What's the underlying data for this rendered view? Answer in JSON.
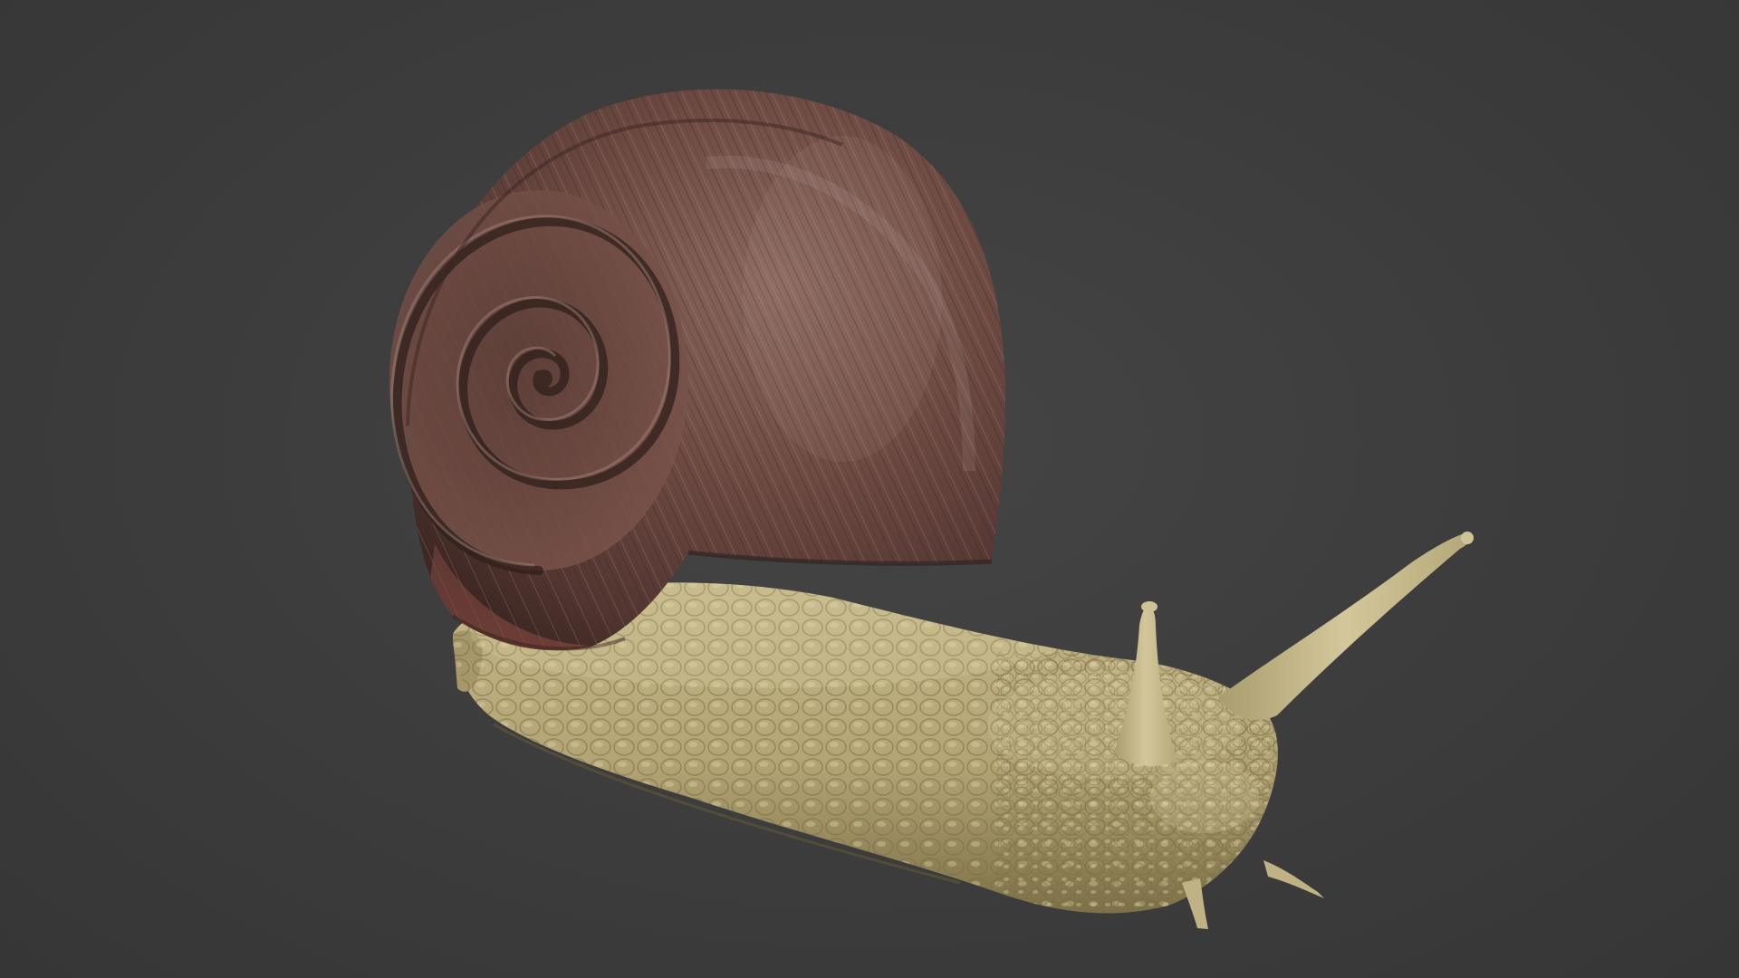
{
  "scene": {
    "subject": "snail-render",
    "colors": {
      "background": "#3d3d3d",
      "shell_base": "#6e4a42",
      "shell_dark": "#3e2a26",
      "shell_highlight": "#9a7870",
      "shell_lip": "#8a4a44",
      "body_base": "#b8aa7c",
      "body_dark": "#8a7c52",
      "body_highlight": "#d6cba0",
      "tentacle": "#c9bd8f"
    }
  }
}
